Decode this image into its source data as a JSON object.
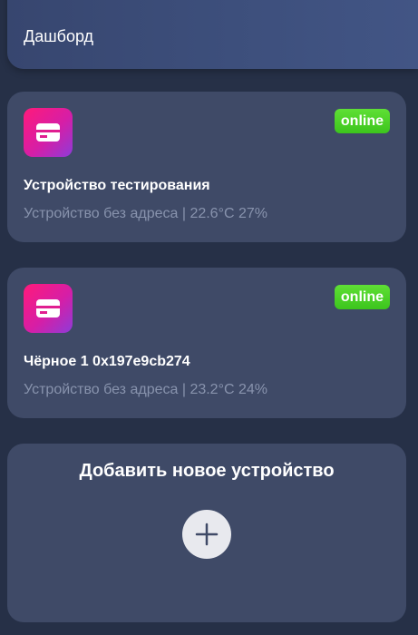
{
  "header": {
    "title": "Дашборд"
  },
  "devices": [
    {
      "status": "online",
      "name": "Устройство тестирования",
      "subtitle": "Устройство без адреса | 22.6°C 27%"
    },
    {
      "status": "online",
      "name": "Чёрное 1 0x197e9cb274",
      "subtitle": "Устройство без адреса | 23.2°C 24%"
    }
  ],
  "add_device": {
    "title": "Добавить новое устройство"
  },
  "colors": {
    "background": "#263047",
    "card": "#3f4a67",
    "online": "#46cc22",
    "icon_gradient_start": "#ff1a7a",
    "icon_gradient_end": "#8e3bd8"
  }
}
